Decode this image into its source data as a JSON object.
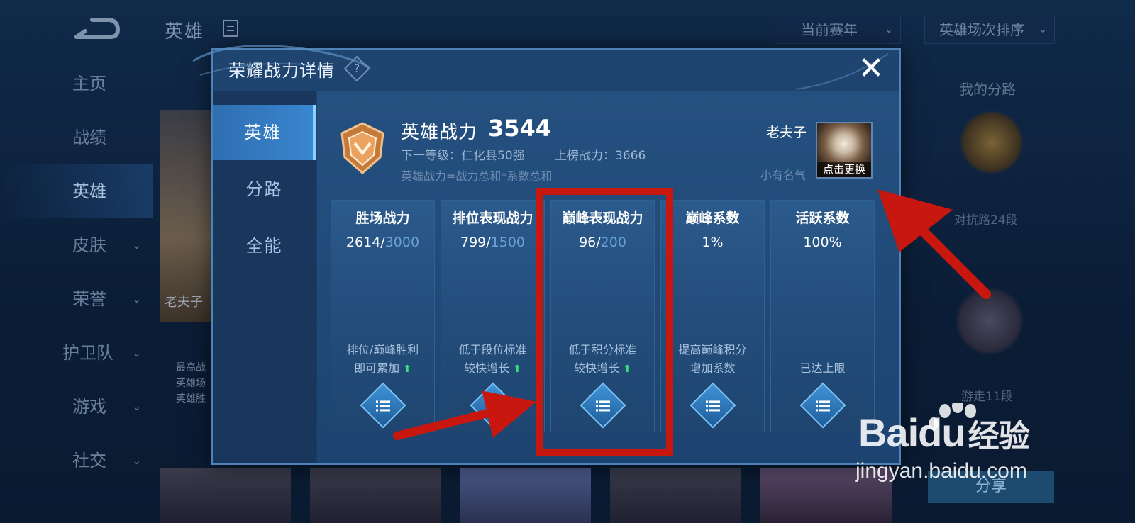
{
  "background": {
    "title": "英雄",
    "dropdown_season": "当前赛年",
    "dropdown_sort": "英雄场次排序",
    "side_nav": [
      "主页",
      "战绩",
      "英雄",
      "皮肤",
      "荣誉",
      "护卫队",
      "游戏",
      "社交"
    ],
    "hero_card_name": "老夫子",
    "hero_card_lines": [
      "最高战",
      "英雄场",
      "英雄胜"
    ],
    "right_panel": {
      "title": "我的分路",
      "lane_text_1": "对抗路24段",
      "lane_text_2": "游走11段",
      "button": "分享"
    }
  },
  "modal": {
    "title": "荣耀战力详情",
    "help_icon": "?",
    "close_icon": "✕",
    "tabs": [
      {
        "label": "英雄",
        "active": true
      },
      {
        "label": "分路",
        "active": false
      },
      {
        "label": "全能",
        "active": false
      }
    ],
    "header": {
      "power_label": "英雄战力",
      "power_value": "3544",
      "next_level": "下一等级：仁化县50强",
      "rank_power": "上榜战力：3666",
      "formula": "英雄战力=战力总和*系数总和",
      "hero_name": "老夫子",
      "hero_title": "小有名气",
      "avatar_button": "点击更换"
    },
    "stats": [
      {
        "title": "胜场战力",
        "value": "2614",
        "max": "3000",
        "hint1": "排位/巅峰胜利",
        "hint2": "即可累加",
        "arrow": true
      },
      {
        "title": "排位表现战力",
        "value": "799",
        "max": "1500",
        "hint1": "低于段位标准",
        "hint2": "较快增长",
        "arrow": true
      },
      {
        "title": "巅峰表现战力",
        "value": "96",
        "max": "200",
        "hint1": "低于积分标准",
        "hint2": "较快增长",
        "arrow": true
      },
      {
        "title": "巅峰系数",
        "value": "1%",
        "max": "",
        "hint1": "提高巅峰积分",
        "hint2": "增加系数",
        "arrow": false
      },
      {
        "title": "活跃系数",
        "value": "100%",
        "max": "",
        "hint1": "",
        "hint2": "已达上限",
        "arrow": false
      }
    ]
  },
  "watermark": {
    "logo_text": "Bai",
    "logo_text_2": "du",
    "logo_cn": "经验",
    "url": "jingyan.baidu.com"
  },
  "colors": {
    "annotation_red": "#c8170f",
    "accent_blue": "#3a86d0",
    "up_green": "#37e07a"
  }
}
